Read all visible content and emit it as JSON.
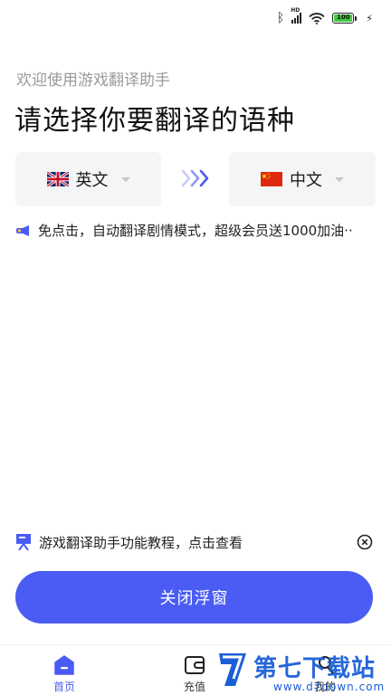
{
  "status_bar": {
    "bluetooth_icon": "bluetooth-icon",
    "network": "HD",
    "wifi_icon": "wifi-icon",
    "battery_level": "100",
    "charging_icon": "lightning-icon"
  },
  "header": {
    "subtitle": "欢迎使用游戏翻译助手",
    "title": "请选择你要翻译的语种"
  },
  "language_selector": {
    "source": {
      "label": "英文",
      "flag": "uk-flag-icon"
    },
    "swap_icon": "triple-chevron-right-icon",
    "target": {
      "label": "中文",
      "flag": "china-flag-icon"
    }
  },
  "promo": {
    "icon": "megaphone-icon",
    "text": "免点击，自动翻译剧情模式，超级会员送1000加油··"
  },
  "tutorial": {
    "icon": "projector-icon",
    "text": "游戏翻译助手功能教程，点击查看",
    "close_icon": "close-circle-icon"
  },
  "cta": {
    "label": "关闭浮窗"
  },
  "bottom_nav": {
    "items": [
      {
        "label": "首页",
        "icon": "home-icon",
        "active": true
      },
      {
        "label": "充值",
        "icon": "wallet-icon",
        "active": false
      },
      {
        "label": "我的",
        "icon": "user-icon",
        "active": false
      }
    ]
  },
  "watermark": {
    "title": "第七下载站",
    "url": "www.d7down.com"
  },
  "colors": {
    "accent": "#4a5cf4",
    "box_bg": "#f4f5f7",
    "subtitle": "#9a9a9a",
    "watermark": "#1b5fd8"
  }
}
